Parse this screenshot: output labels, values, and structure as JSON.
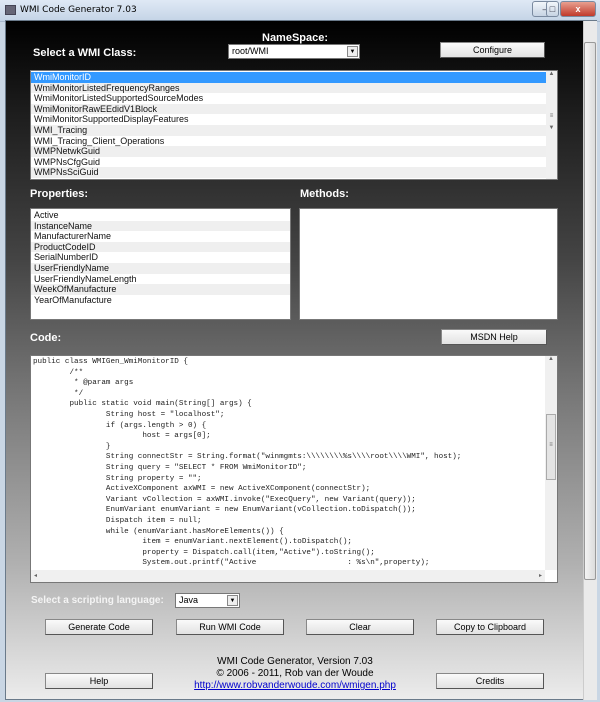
{
  "window": {
    "title": "WMI Code Generator 7.03",
    "minimize": "–",
    "maximize": "□",
    "close": "x"
  },
  "namespace": {
    "label": "NameSpace:",
    "value": "root/WMI"
  },
  "class_label": "Select a WMI Class:",
  "configure_label": "Configure",
  "classes": {
    "selected": "WmiMonitorID",
    "items": [
      "WmiMonitorID",
      "WmiMonitorListedFrequencyRanges",
      "WmiMonitorListedSupportedSourceModes",
      "WmiMonitorRawEEdidV1Block",
      "WmiMonitorSupportedDisplayFeatures",
      "WMI_Tracing",
      "WMI_Tracing_Client_Operations",
      "WMPNetwkGuid",
      "WMPNsCfgGuid",
      "WMPNsSciGuid"
    ]
  },
  "properties": {
    "label": "Properties:",
    "items": [
      "Active",
      "InstanceName",
      "ManufacturerName",
      "ProductCodeID",
      "SerialNumberID",
      "UserFriendlyName",
      "UserFriendlyNameLength",
      "WeekOfManufacture",
      "YearOfManufacture"
    ]
  },
  "methods": {
    "label": "Methods:"
  },
  "code": {
    "label": "Code:",
    "msdn_label": "MSDN Help",
    "text": "public class WMIGen_WmiMonitorID {\n        /**\n         * @param args\n         */\n        public static void main(String[] args) {\n                String host = \"localhost\";\n                if (args.length > 0) {\n                        host = args[0];\n                }\n                String connectStr = String.format(\"winmgmts:\\\\\\\\\\\\\\\\%s\\\\\\\\root\\\\\\\\WMI\", host);\n                String query = \"SELECT * FROM WmiMonitorID\";\n                String property = \"\";\n                ActiveXComponent axWMI = new ActiveXComponent(connectStr);\n                Variant vCollection = axWMI.invoke(\"ExecQuery\", new Variant(query));\n                EnumVariant enumVariant = new EnumVariant(vCollection.toDispatch());\n                Dispatch item = null;\n                while (enumVariant.hasMoreElements()) {\n                        item = enumVariant.nextElement().toDispatch();\n                        property = Dispatch.call(item,\"Active\").toString();\n                        System.out.printf(\"Active                    : %s\\n\",property);"
  },
  "language": {
    "label": "Select a scripting language:",
    "value": "Java"
  },
  "buttons": {
    "generate": "Generate Code",
    "run": "Run WMI Code",
    "clear": "Clear",
    "copy": "Copy to Clipboard",
    "help": "Help",
    "credits": "Credits"
  },
  "footer": {
    "line1": "WMI Code Generator,  Version 7.03",
    "line2": "© 2006 - 2011, Rob van der Woude",
    "link": "http://www.robvanderwoude.com/wmigen.php"
  }
}
